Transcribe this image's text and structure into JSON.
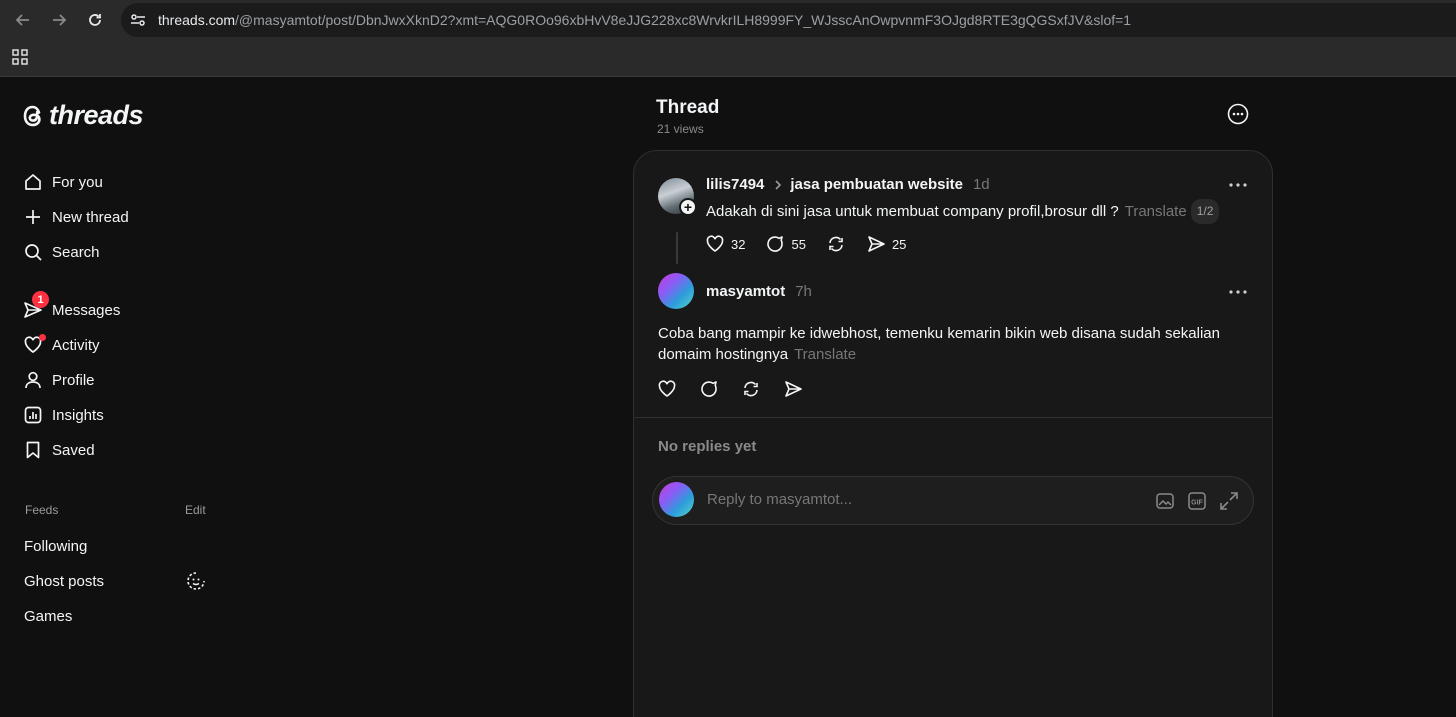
{
  "browser": {
    "url_host": "threads.com",
    "url_rest": "/@masyamtot/post/DbnJwxXknD2?xmt=AQG0ROo96xbHvV8eJJG228xc8WrvkrILH8999FY_WJsscAnOwpvnmF3OJgd8RTE3gQGSxfJV&slof=1"
  },
  "sidebar": {
    "logo_text": "threads",
    "nav": [
      {
        "label": "For you",
        "icon": "home-icon"
      },
      {
        "label": "New thread",
        "icon": "plus-icon"
      },
      {
        "label": "Search",
        "icon": "search-icon"
      },
      {
        "label": "Messages",
        "icon": "send-icon",
        "badge": "1"
      },
      {
        "label": "Activity",
        "icon": "heart-icon"
      },
      {
        "label": "Profile",
        "icon": "person-icon"
      },
      {
        "label": "Insights",
        "icon": "chart-icon"
      },
      {
        "label": "Saved",
        "icon": "bookmark-icon"
      }
    ],
    "feeds_title": "Feeds",
    "feeds_edit": "Edit",
    "feeds": [
      "Following",
      "Ghost posts",
      "Games"
    ]
  },
  "main": {
    "title": "Thread",
    "views": "21 views",
    "original_post": {
      "username": "lilis7494",
      "topic": "jasa pembuatan website",
      "time": "1d",
      "text": "Adakah di sini jasa untuk membuat company profil,brosur dll ?",
      "translate": "Translate",
      "page": "1/2",
      "likes": "32",
      "comments": "55",
      "shares": "25"
    },
    "reply_post": {
      "username": "masyamtot",
      "time": "7h",
      "text": "Coba bang mampir ke idwebhost, temenku kemarin bikin web disana sudah sekalian domaim hostingnya",
      "translate": "Translate"
    },
    "no_replies": "No replies yet",
    "reply_placeholder": "Reply to masyamtot..."
  },
  "colors": {
    "background": "#101010",
    "card": "#181818",
    "text": "#f3f5f7",
    "muted": "#777777",
    "badge": "#ff3040"
  }
}
